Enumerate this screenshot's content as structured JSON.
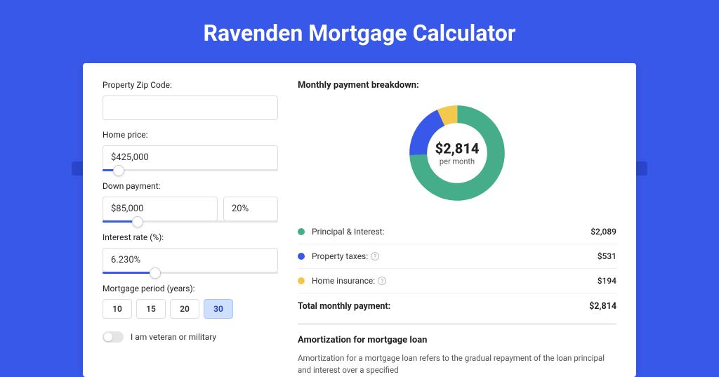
{
  "title": "Ravenden Mortgage Calculator",
  "form": {
    "zip_label": "Property Zip Code:",
    "zip_value": "",
    "price_label": "Home price:",
    "price_value": "$425,000",
    "price_slider_pct": 9,
    "dp_label": "Down payment:",
    "dp_value": "$85,000",
    "dp_pct_value": "20%",
    "dp_slider_pct": 20,
    "rate_label": "Interest rate (%):",
    "rate_value": "6.230%",
    "rate_slider_pct": 30,
    "period_label": "Mortgage period (years):",
    "periods": [
      "10",
      "15",
      "20",
      "30"
    ],
    "period_active": "30",
    "veteran_label": "I am veteran or military"
  },
  "breakdown": {
    "title": "Monthly payment breakdown:",
    "donut_amount": "$2,814",
    "donut_sub": "per month",
    "items": [
      {
        "label": "Principal & Interest:",
        "value": "$2,089",
        "color": "#45ad8a",
        "info": false
      },
      {
        "label": "Property taxes:",
        "value": "$531",
        "color": "#3858e9",
        "info": true
      },
      {
        "label": "Home insurance:",
        "value": "$194",
        "color": "#f2c94c",
        "info": true
      }
    ],
    "total_label": "Total monthly payment:",
    "total_value": "$2,814"
  },
  "chart_data": {
    "type": "pie",
    "title": "Monthly payment breakdown",
    "series": [
      {
        "name": "Principal & Interest",
        "value": 2089,
        "color": "#45ad8a"
      },
      {
        "name": "Property taxes",
        "value": 531,
        "color": "#3858e9"
      },
      {
        "name": "Home insurance",
        "value": 194,
        "color": "#f2c94c"
      }
    ],
    "total": 2814,
    "center_label": "$2,814 per month"
  },
  "amort": {
    "title": "Amortization for mortgage loan",
    "text": "Amortization for a mortgage loan refers to the gradual repayment of the loan principal and interest over a specified"
  }
}
